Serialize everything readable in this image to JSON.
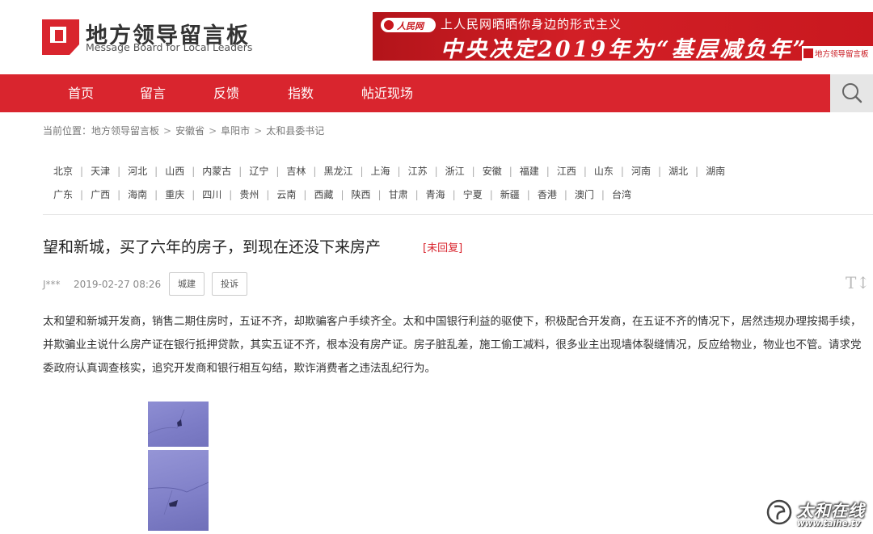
{
  "site": {
    "name": "地方领导留言板",
    "name_en": "Message Board for Local Leaders"
  },
  "banner": {
    "logo_text": "人民网",
    "top_line": "上人民网晒晒你身边的形式主义",
    "main_line": "中央决定2019年为“基层减负年”",
    "badge_text": "地方领导留言板"
  },
  "nav": {
    "items": [
      "首页",
      "留言",
      "反馈",
      "指数",
      "帖近现场"
    ],
    "search_icon": "search-icon"
  },
  "breadcrumb": {
    "prefix": "当前位置：",
    "items": [
      "地方领导留言板",
      "安徽省",
      "阜阳市",
      "太和县委书记"
    ]
  },
  "provinces": {
    "row1": [
      "北京",
      "天津",
      "河北",
      "山西",
      "内蒙古",
      "辽宁",
      "吉林",
      "黑龙江",
      "上海",
      "江苏",
      "浙江",
      "安徽",
      "福建",
      "江西",
      "山东",
      "河南",
      "湖北",
      "湖南"
    ],
    "row2": [
      "广东",
      "广西",
      "海南",
      "重庆",
      "四川",
      "贵州",
      "云南",
      "西藏",
      "陕西",
      "甘肃",
      "青海",
      "宁夏",
      "新疆",
      "香港",
      "澳门",
      "台湾"
    ]
  },
  "post": {
    "title": "望和新城，买了六年的房子，到现在还没下来房产",
    "status": "[未回复]",
    "author": "J***",
    "date": "2019-02-27 08:26",
    "tags": [
      "城建",
      "投诉"
    ],
    "font_toggle": "T↕",
    "body": [
      "太和望和新城开发商，销售二期住房时，五证不齐，却欺骗客户手续齐全。太和中国银行利益的驱使下，积极配合开发商，在五证不齐的情况下，居然违规办理按揭手续，",
      "并欺骗业主说什么房产证在银行抵押贷款，其实五证不齐，根本没有房产证。房子脏乱差，施工偷工减料，很多业主出现墙体裂缝情况，反应给物业，物业也不管。请求党",
      "委政府认真调查核实，追究开发商和银行相互勾结，欺诈消费者之违法乱纪行为。"
    ]
  },
  "watermark": {
    "text": "太和在线",
    "url": "www.taihe.tv"
  },
  "colors": {
    "brand_red": "#d9252e",
    "nav_text": "#ffffff",
    "status_red": "#d9252e"
  }
}
